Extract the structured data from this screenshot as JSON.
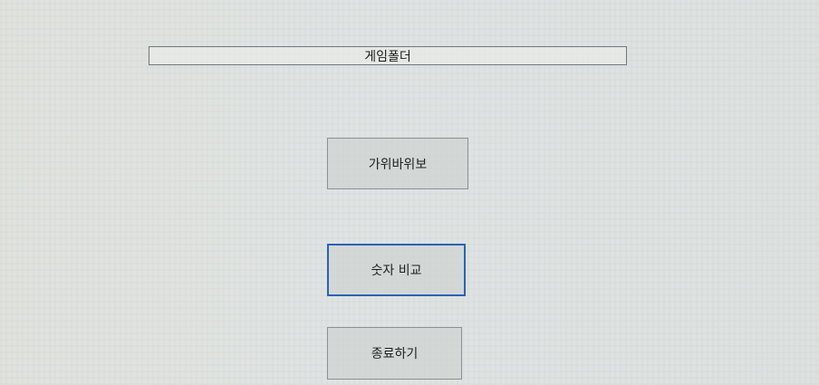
{
  "header": {
    "title": "게임폴더"
  },
  "menu": {
    "rps_label": "가위바위보",
    "number_compare_label": "숫자 비교",
    "exit_label": "종료하기"
  },
  "colors": {
    "background": "#dde1df",
    "button_border": "#8a9296",
    "focus_border": "#2a62b5"
  }
}
